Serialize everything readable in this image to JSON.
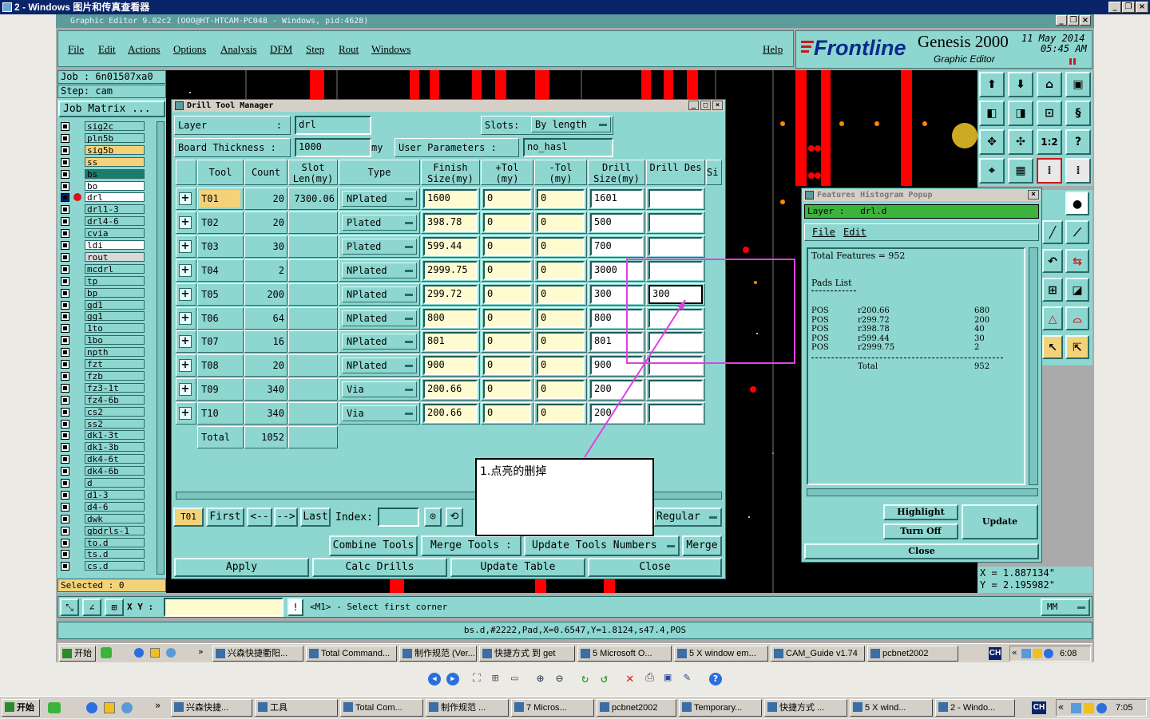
{
  "viewer": {
    "title": "2 - Windows 图片和传真查看器"
  },
  "app": {
    "title": "Graphic Editor 9.02c2 (OOO@HT-HTCAM-PC048 - Windows, pid:4628)",
    "menu": [
      "File",
      "Edit",
      "Actions",
      "Options",
      "Analysis",
      "DFM",
      "Step",
      "Rout",
      "Windows",
      "Help"
    ],
    "brand": {
      "logo": "Frontline",
      "product": "Genesis 2000",
      "subtitle": "Graphic Editor",
      "date": "11 May 2014",
      "time": "05:45 AM"
    }
  },
  "left": {
    "job_label": "Job :",
    "job": "6n01507xa0",
    "step_label": "Step:",
    "step": "cam",
    "matrix_button": "Job Matrix ...",
    "layers": [
      "sig2c",
      "pln5b",
      "sig5b",
      "ss",
      "bs",
      "bo",
      "drl",
      "drl1-3",
      "drl4-6",
      "cvia",
      "ldi",
      "rout",
      "mcdrl",
      "tp",
      "bp",
      "gd1",
      "gg1",
      "1to",
      "1bo",
      "npth",
      "fzt",
      "fzb",
      "fz3-1t",
      "fz4-6b",
      "cs2",
      "ss2",
      "dk1-3t",
      "dk1-3b",
      "dk4-6t",
      "dk4-6b",
      "d",
      "d1-3",
      "d4-6",
      "dwk",
      "gbdrls-1",
      "to.d",
      "ts.d",
      "cs.d"
    ],
    "selected": "Selected : 0"
  },
  "drill": {
    "title": "Drill Tool Manager",
    "layer_label": "Layer",
    "layer_sep": ":",
    "layer_value": "drl",
    "slots_label": "Slots:",
    "slots_value": "By length",
    "thickness_label": "Board Thickness :",
    "thickness_value": "1000",
    "thickness_unit": "my",
    "user_params_label": "User Parameters :",
    "user_params_value": "no_hasl",
    "columns": [
      "Tool",
      "Count",
      "Slot Len(my)",
      "Type",
      "Finish Size(my)",
      "+Tol (my)",
      "-Tol (my)",
      "Drill Size(my)",
      "Drill Des",
      "Si"
    ],
    "rows": [
      {
        "tool": "T01",
        "count": "20",
        "slot": "7300.06",
        "type": "NPlated",
        "finish": "1600",
        "ptol": "0",
        "mtol": "0",
        "drill": "1601",
        "des": ""
      },
      {
        "tool": "T02",
        "count": "20",
        "slot": "",
        "type": "Plated",
        "finish": "398.78",
        "ptol": "0",
        "mtol": "0",
        "drill": "500",
        "des": ""
      },
      {
        "tool": "T03",
        "count": "30",
        "slot": "",
        "type": "Plated",
        "finish": "599.44",
        "ptol": "0",
        "mtol": "0",
        "drill": "700",
        "des": ""
      },
      {
        "tool": "T04",
        "count": "2",
        "slot": "",
        "type": "NPlated",
        "finish": "2999.75",
        "ptol": "0",
        "mtol": "0",
        "drill": "3000",
        "des": ""
      },
      {
        "tool": "T05",
        "count": "200",
        "slot": "",
        "type": "NPlated",
        "finish": "299.72",
        "ptol": "0",
        "mtol": "0",
        "drill": "300",
        "des": "300"
      },
      {
        "tool": "T06",
        "count": "64",
        "slot": "",
        "type": "NPlated",
        "finish": "800",
        "ptol": "0",
        "mtol": "0",
        "drill": "800",
        "des": ""
      },
      {
        "tool": "T07",
        "count": "16",
        "slot": "",
        "type": "NPlated",
        "finish": "801",
        "ptol": "0",
        "mtol": "0",
        "drill": "801",
        "des": ""
      },
      {
        "tool": "T08",
        "count": "20",
        "slot": "",
        "type": "NPlated",
        "finish": "900",
        "ptol": "0",
        "mtol": "0",
        "drill": "900",
        "des": ""
      },
      {
        "tool": "T09",
        "count": "340",
        "slot": "",
        "type": "Via",
        "finish": "200.66",
        "ptol": "0",
        "mtol": "0",
        "drill": "200",
        "des": ""
      },
      {
        "tool": "T10",
        "count": "340",
        "slot": "",
        "type": "Via",
        "finish": "200.66",
        "ptol": "0",
        "mtol": "0",
        "drill": "200",
        "des": ""
      }
    ],
    "total_label": "Total",
    "total_value": "1052",
    "nav": {
      "current": "T01",
      "first": "First",
      "prev": "<--",
      "next": "-->",
      "last": "Last",
      "index_label": "Index:",
      "mode": "Regular"
    },
    "buttons": {
      "combine": "Combine Tools",
      "merge_tools": "Merge Tools :",
      "update_numbers": "Update Tools Numbers",
      "merge": "Merge",
      "apply": "Apply",
      "calc": "Calc Drills",
      "update_table": "Update Table",
      "close": "Close"
    }
  },
  "annotation": {
    "text": "1.点亮的删掉"
  },
  "features": {
    "title": "Features Histogram Popup",
    "layer_line": "Layer :   drl.d",
    "menu": [
      "File",
      "Edit"
    ],
    "total_line": "Total Features = 952",
    "pads_title": "Pads List",
    "pads": [
      {
        "kind": "POS",
        "sym": "r200.66",
        "count": "680"
      },
      {
        "kind": "POS",
        "sym": "r299.72",
        "count": "200"
      },
      {
        "kind": "POS",
        "sym": "r398.78",
        "count": "40"
      },
      {
        "kind": "POS",
        "sym": "r599.44",
        "count": "30"
      },
      {
        "kind": "POS",
        "sym": "r2999.75",
        "count": "2"
      }
    ],
    "total_label": "Total",
    "total_value": "952",
    "highlight": "Highlight",
    "turn_off": "Turn Off",
    "update": "Update",
    "close": "Close"
  },
  "coords": {
    "x": "X  =  1.887134\"",
    "y": "Y  =  2.195982\""
  },
  "status": {
    "xy_label": "X Y :",
    "prompt": "<M1> - Select first corner",
    "unit": "MM",
    "info": "bs.d,#2222,Pad,X=0.6547,Y=1.8124,s47.4,POS"
  },
  "taskbar_inner": {
    "start": "开始",
    "items": [
      "兴森快捷衢阳...",
      "Total Command...",
      "制作规范 (Ver...",
      "快捷方式 到 get",
      "5 Microsoft O...",
      "5 X window em...",
      "CAM_Guide v1.74",
      "pcbnet2002"
    ],
    "lang": "CH",
    "clock": "6:08"
  },
  "taskbar_outer": {
    "start": "开始",
    "items": [
      "兴森快捷...",
      "工具",
      "Total Com...",
      "制作规范 ...",
      "7 Micros...",
      "pcbnet2002",
      "Temporary...",
      "快捷方式 ...",
      "5 X wind...",
      "2 - Windo..."
    ],
    "lang": "CH",
    "clock": "7:05"
  }
}
